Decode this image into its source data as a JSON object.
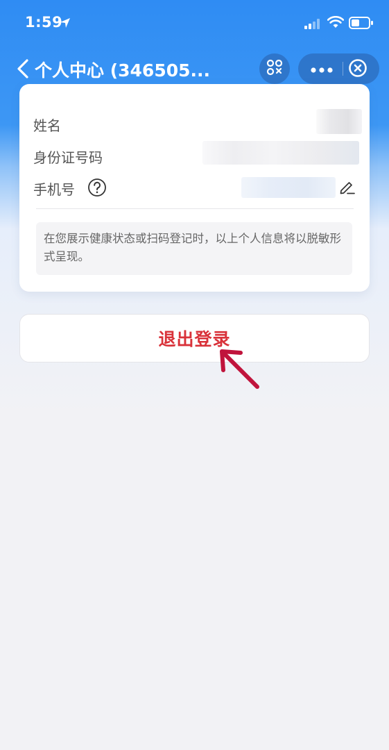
{
  "status_bar": {
    "time": "1:59"
  },
  "nav": {
    "title": "个人中心 (346505...",
    "icons": [
      "back-chevron-icon",
      "scan-icon",
      "more-dots-icon",
      "close-circle-icon"
    ]
  },
  "profile_card": {
    "name_label": "姓名",
    "id_label": "身份证号码",
    "phone_label": "手机号",
    "name_value_blurred": true,
    "id_value_blurred": true,
    "phone_value_blurred": true,
    "notice": "在您展示健康状态或扫码登记时，以上个人信息将以脱敏形式呈现。"
  },
  "logout": {
    "label": "退出登录"
  },
  "colors": {
    "header_blue": "#2f8cf3",
    "logout_red": "#d9323a",
    "annotation_arrow": "#c0143c"
  }
}
